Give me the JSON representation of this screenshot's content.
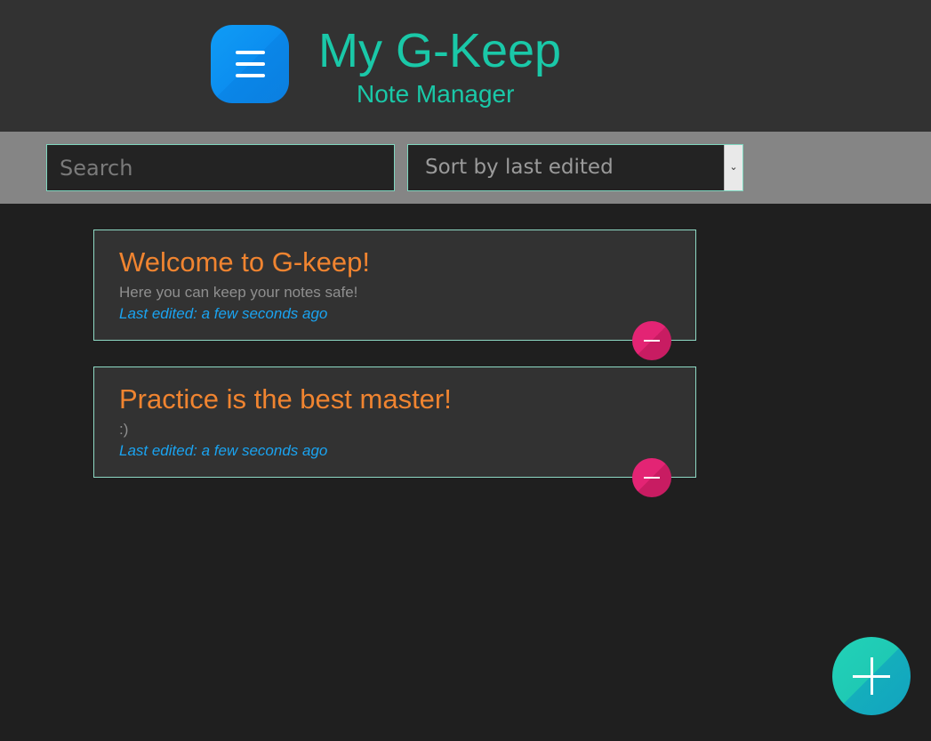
{
  "app": {
    "title": "My G-Keep",
    "subtitle": "Note Manager",
    "accent": "#1ac8a8"
  },
  "icons": {
    "menu": "menu-icon",
    "delete": "minus-icon",
    "add": "plus-icon"
  },
  "toolbar": {
    "search_placeholder": "Search",
    "search_value": "",
    "sort_selected": "Sort by last edited"
  },
  "notes": [
    {
      "title": "Welcome to G-keep!",
      "body": "Here you can keep your notes safe!",
      "edited": "Last edited: a few seconds ago"
    },
    {
      "title": "Practice is the best master!",
      "body": ":)",
      "edited": "Last edited: a few seconds ago"
    }
  ],
  "colors": {
    "note_title": "#f08430",
    "edited_text": "#1aa3f0",
    "delete_button": "#e32474",
    "add_button": "#1fc9b4"
  }
}
